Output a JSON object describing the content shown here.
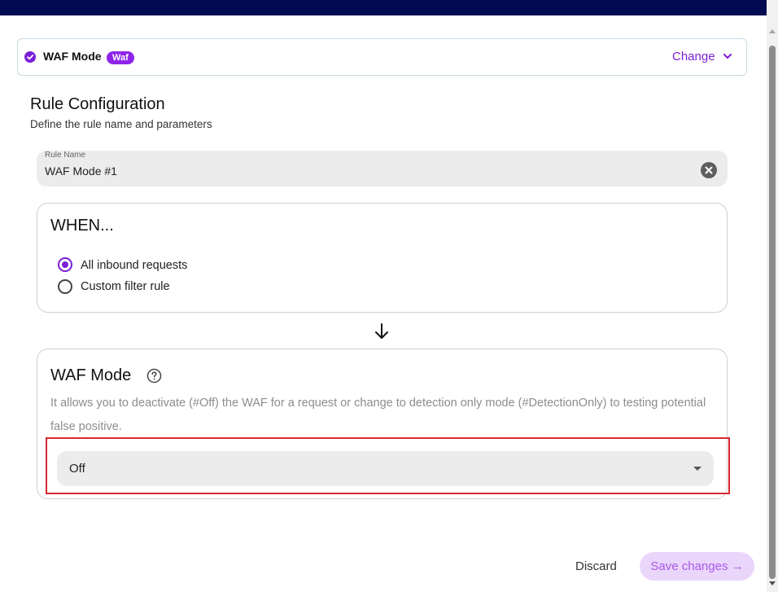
{
  "mode_header": {
    "title": "WAF Mode",
    "badge": "Waf",
    "change_label": "Change"
  },
  "rule_config": {
    "title": "Rule Configuration",
    "subtitle": "Define the rule name and parameters",
    "name_label": "Rule Name",
    "name_value": "WAF Mode #1"
  },
  "when": {
    "title": "WHEN...",
    "options": [
      {
        "label": "All inbound requests",
        "selected": true
      },
      {
        "label": "Custom filter rule",
        "selected": false
      }
    ]
  },
  "waf_mode": {
    "title": "WAF Mode",
    "description": "It allows you to deactivate (#Off) the WAF for a request or change to detection only mode (#DetectionOnly) to testing potential false positive.",
    "selected_value": "Off"
  },
  "footer": {
    "discard_label": "Discard",
    "save_label": "Save changes →"
  },
  "colors": {
    "accent": "#7b1fd6",
    "top_bar": "#020a52",
    "highlight": "#d8292e",
    "save_bg": "#ead5fb"
  },
  "icons": [
    "check-circle-icon",
    "chevron-down-icon",
    "clear-icon",
    "arrow-down-icon",
    "help-circle-icon",
    "caret-down-icon"
  ]
}
